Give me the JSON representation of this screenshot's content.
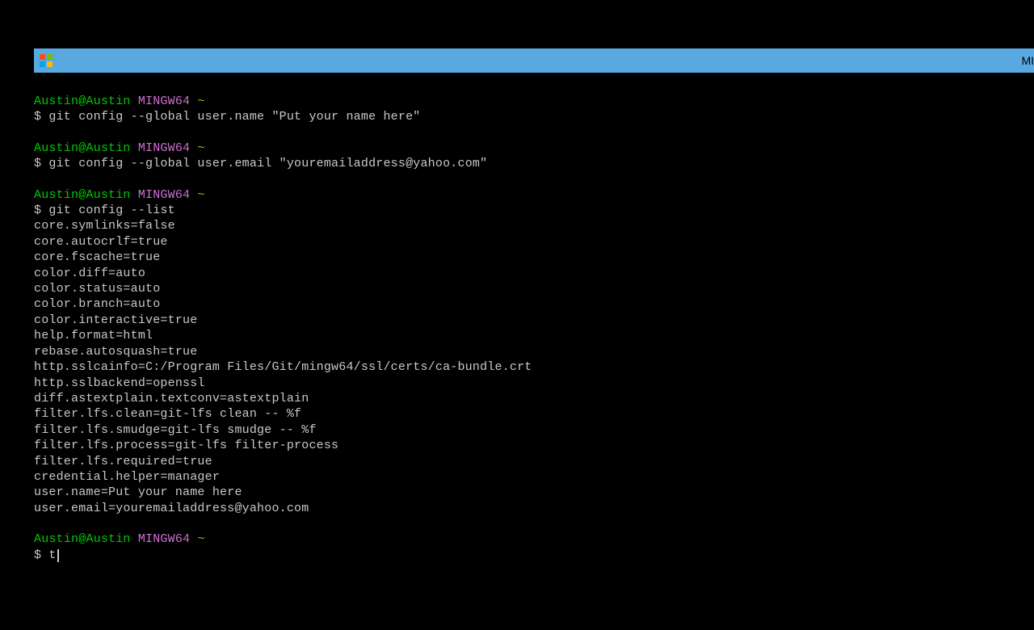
{
  "title_bar": {
    "title_partial": "MI"
  },
  "blocks": [
    {
      "prompt": {
        "user_host": "Austin@Austin",
        "env": "MINGW64",
        "path": "~"
      },
      "command": "git config --global user.name \"Put your name here\"",
      "output": []
    },
    {
      "prompt": {
        "user_host": "Austin@Austin",
        "env": "MINGW64",
        "path": "~"
      },
      "command": "git config --global user.email \"youremailaddress@yahoo.com\"",
      "output": []
    },
    {
      "prompt": {
        "user_host": "Austin@Austin",
        "env": "MINGW64",
        "path": "~"
      },
      "command": "git config --list",
      "output": [
        "core.symlinks=false",
        "core.autocrlf=true",
        "core.fscache=true",
        "color.diff=auto",
        "color.status=auto",
        "color.branch=auto",
        "color.interactive=true",
        "help.format=html",
        "rebase.autosquash=true",
        "http.sslcainfo=C:/Program Files/Git/mingw64/ssl/certs/ca-bundle.crt",
        "http.sslbackend=openssl",
        "diff.astextplain.textconv=astextplain",
        "filter.lfs.clean=git-lfs clean -- %f",
        "filter.lfs.smudge=git-lfs smudge -- %f",
        "filter.lfs.process=git-lfs filter-process",
        "filter.lfs.required=true",
        "credential.helper=manager",
        "user.name=Put your name here",
        "user.email=youremailaddress@yahoo.com"
      ]
    },
    {
      "prompt": {
        "user_host": "Austin@Austin",
        "env": "MINGW64",
        "path": "~"
      },
      "command": "t",
      "output": [],
      "active": true
    }
  ]
}
